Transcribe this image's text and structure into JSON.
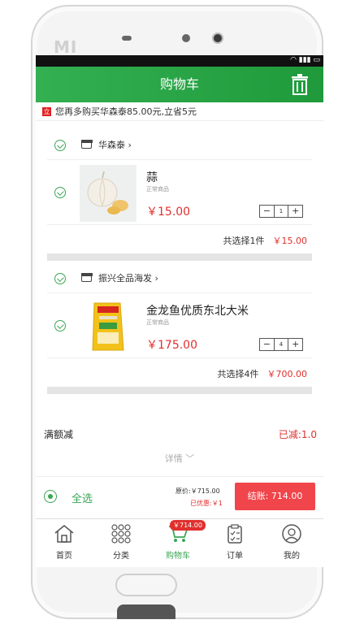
{
  "header": {
    "title": "购物车"
  },
  "promo": {
    "tag": " ",
    "text": "您再多购买华森泰85.00元,立省5元"
  },
  "stores": [
    {
      "name": "华森泰 ›",
      "item": {
        "title": "蒜",
        "subtitle": "正常商品",
        "price": "￥15.00",
        "qty": "1"
      },
      "summary_label": "共选择1件",
      "summary_total": "￥15.00"
    },
    {
      "name": "振兴全品海发 ›",
      "item": {
        "title": "金龙鱼优质东北大米",
        "subtitle": "正常商品",
        "price": "￥175.00",
        "qty": "4"
      },
      "summary_label": "共选择4件",
      "summary_total": "￥700.00"
    }
  ],
  "stepper": {
    "minus": "−",
    "plus": "+"
  },
  "discount": {
    "label": "满额减",
    "value": "已减:1.0"
  },
  "detail": {
    "label": "详情 ﹀"
  },
  "checkout": {
    "select_all": "全选",
    "original_price": "原价:￥715.00",
    "saved": "已优惠:￥1",
    "pay_label": "结账: 714.00"
  },
  "tabbar": {
    "cart_badge": "￥714.00",
    "tabs": [
      {
        "label": "首页",
        "icon": "home-icon"
      },
      {
        "label": "分类",
        "icon": "grid-icon"
      },
      {
        "label": "购物车",
        "icon": "cart-icon"
      },
      {
        "label": "订单",
        "icon": "clipboard-icon"
      },
      {
        "label": "我的",
        "icon": "user-icon"
      }
    ]
  },
  "colors": {
    "accent": "#33b052",
    "price": "#e0302e",
    "pay": "#f0454b"
  }
}
